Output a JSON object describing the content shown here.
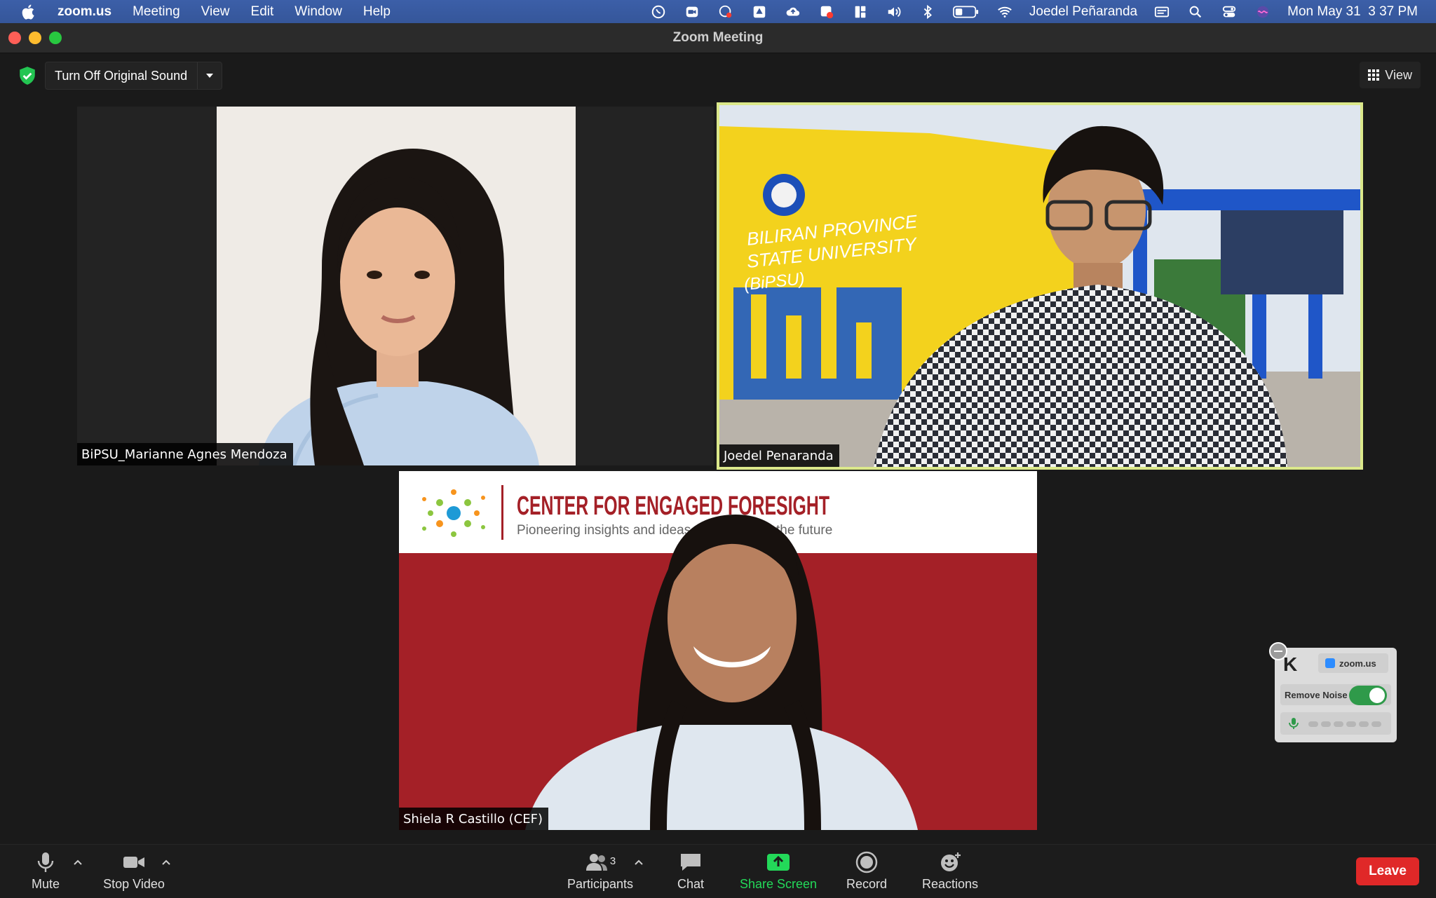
{
  "menubar": {
    "app_name": "zoom.us",
    "menus": [
      "Meeting",
      "View",
      "Edit",
      "Window",
      "Help"
    ],
    "user_name": "Joedel Peñaranda",
    "clock": "Mon May 31  3 37 PM"
  },
  "window": {
    "title": "Zoom Meeting"
  },
  "meeting": {
    "original_sound_label": "Turn Off Original Sound",
    "view_label": "View",
    "participants": [
      {
        "name": "BiPSU_Marianne Agnes Mendoza"
      },
      {
        "name": "Joedel Penaranda",
        "active_speaker": true
      },
      {
        "name": "Shiela R Castillo (CEF)"
      }
    ],
    "background_text": {
      "university_sign": [
        "BILIRAN PROVINCE",
        "STATE UNIVERSITY",
        "(BiPSU)"
      ],
      "cef_title": "CENTER FOR ENGAGED FORESIGHT",
      "cef_subtitle": "Pioneering insights and ideas",
      "cef_subtitle_end": "the future"
    }
  },
  "krisp": {
    "app_label": "zoom.us",
    "remove_noise_label": "Remove Noise",
    "remove_noise_on": true
  },
  "toolbar": {
    "mute": "Mute",
    "stop_video": "Stop Video",
    "participants": "Participants",
    "participant_count": "3",
    "chat": "Chat",
    "share_screen": "Share Screen",
    "record": "Record",
    "reactions": "Reactions",
    "leave": "Leave"
  },
  "colors": {
    "menubar": "#3c5fa8",
    "active_speaker_border": "#dbe88a",
    "share_screen": "#23d959",
    "leave": "#e02828",
    "cef_red": "#a42027"
  }
}
